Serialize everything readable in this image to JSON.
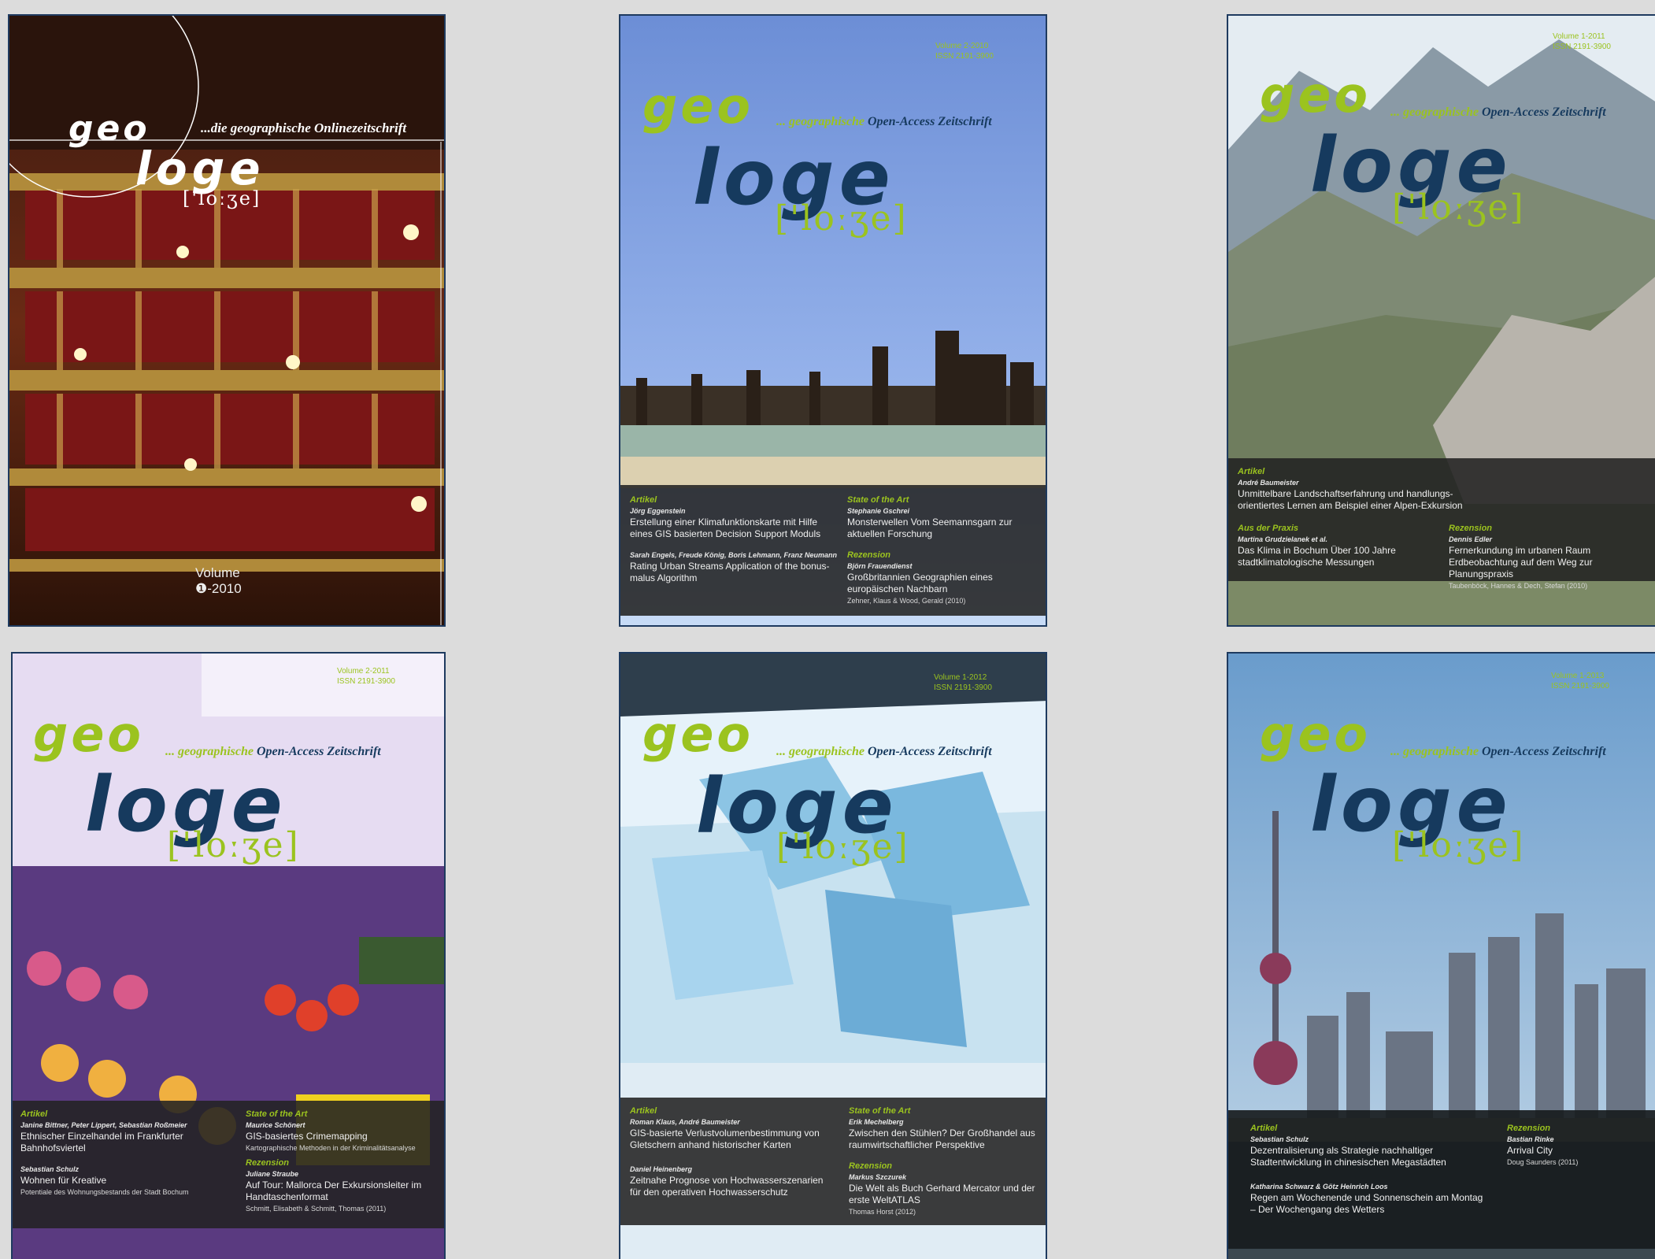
{
  "covers": [
    {
      "geo": "geo",
      "loge": "loge",
      "phonetic": "['loːʒe]",
      "tagline": "...die geographische Onlinezeitschrift",
      "volume_label": "Volume",
      "volume_number": "❶-2010"
    },
    {
      "geo": "geo",
      "loge": "loge",
      "phonetic": "['loːʒe]",
      "tagline_a": "... geographische",
      "tagline_b": "Open-Access Zeitschrift",
      "volume": "Volume 2-2010",
      "issn": "ISSN 2191-3900",
      "sections": [
        {
          "heading": "Artikel",
          "author": "Jörg Eggenstein",
          "title": "Erstellung einer Klimafunktionskarte mit Hilfe eines GIS basierten Decision Support Moduls"
        },
        {
          "heading": "",
          "author": "Sarah Engels, Freude König, Boris Lehmann, Franz Neumann",
          "title": "Rating Urban Streams Application of the bonus-malus Algorithm"
        },
        {
          "heading": "State of the Art",
          "author": "Stephanie Gschrei",
          "title": "Monsterwellen Vom Seemannsgarn zur aktuellen Forschung"
        },
        {
          "heading": "Rezension",
          "author": "Björn Frauendienst",
          "title": "Großbritannien Geographien eines europäischen Nachbarn",
          "citation": "Zehner, Klaus & Wood, Gerald (2010)"
        }
      ]
    },
    {
      "geo": "geo",
      "loge": "loge",
      "phonetic": "['loːʒe]",
      "tagline_a": "... geographische",
      "tagline_b": "Open-Access Zeitschrift",
      "volume": "Volume 1-2011",
      "issn": "ISSN 2191-3900",
      "sections": [
        {
          "heading": "Artikel",
          "author": "André Baumeister",
          "title": "Unmittelbare Landschaftserfahrung und handlungs-orientiertes Lernen am Beispiel einer Alpen-Exkursion"
        },
        {
          "heading": "Aus der Praxis",
          "author": "Martina Grudzielanek et al.",
          "title": "Das Klima in Bochum Über 100 Jahre stadtklimatologische Messungen"
        },
        {
          "heading": "Rezension",
          "author": "Dennis Edler",
          "title": "Fernerkundung im urbanen Raum Erdbeobachtung auf dem Weg zur Planungspraxis",
          "citation": "Taubenböck, Hannes & Dech, Stefan (2010)"
        }
      ]
    },
    {
      "geo": "geo",
      "loge": "loge",
      "phonetic": "['loːʒe]",
      "tagline_a": "... geographische",
      "tagline_b": "Open-Access Zeitschrift",
      "volume": "Volume 2-2011",
      "issn": "ISSN 2191-3900",
      "sections": [
        {
          "heading": "Artikel",
          "author": "Janine Bittner, Peter Lippert, Sebastian Roßmeier",
          "title": "Ethnischer Einzelhandel im Frankfurter Bahnhofsviertel"
        },
        {
          "heading": "",
          "author": "Sebastian Schulz",
          "title": "Wohnen für Kreative",
          "citation": "Potentiale des Wohnungsbestands der Stadt Bochum"
        },
        {
          "heading": "State of the Art",
          "author": "Maurice Schönert",
          "title": "GIS-basiertes Crimemapping",
          "citation": "Kartographische Methoden in der Kriminalitätsanalyse"
        },
        {
          "heading": "Rezension",
          "author": "Juliane Straube",
          "title": "Auf Tour: Mallorca Der Exkursionsleiter im Handtaschenformat",
          "citation": "Schmitt, Elisabeth & Schmitt, Thomas (2011)"
        }
      ]
    },
    {
      "geo": "geo",
      "loge": "loge",
      "phonetic": "['loːʒe]",
      "tagline_a": "... geographische",
      "tagline_b": "Open-Access Zeitschrift",
      "volume": "Volume 1-2012",
      "issn": "ISSN 2191-3900",
      "sections": [
        {
          "heading": "Artikel",
          "author": "Roman Klaus, André Baumeister",
          "title": "GIS-basierte Verlustvolumenbestimmung von Gletschern anhand historischer Karten"
        },
        {
          "heading": "",
          "author": "Daniel Heinenberg",
          "title": "Zeitnahe Prognose von Hochwasserszenarien für den operativen Hochwasserschutz"
        },
        {
          "heading": "State of the Art",
          "author": "Erik Mechelberg",
          "title": "Zwischen den Stühlen? Der Großhandel aus raumwirtschaftlicher Perspektive"
        },
        {
          "heading": "Rezension",
          "author": "Markus Szczurek",
          "title": "Die Welt als Buch Gerhard Mercator und der erste WeltATLAS",
          "citation": "Thomas Horst (2012)"
        }
      ]
    },
    {
      "geo": "geo",
      "loge": "loge",
      "phonetic": "['loːʒe]",
      "tagline_a": "... geographische",
      "tagline_b": "Open-Access Zeitschrift",
      "volume": "Volume 1-2013",
      "issn": "ISSN 2191-3900",
      "sections": [
        {
          "heading": "Artikel",
          "author": "Sebastian Schulz",
          "title": "Dezentralisierung als Strategie nachhaltiger Stadtentwicklung in chinesischen Megastädten"
        },
        {
          "heading": "",
          "author": "Katharina Schwarz & Götz Heinrich Loos",
          "title": "Regen am Wochenende und Sonnenschein am Montag – Der Wochengang des Wetters"
        },
        {
          "heading": "Rezension",
          "author": "Bastian Rinke",
          "title": "Arrival City",
          "citation": "Doug Saunders (2011)"
        }
      ]
    }
  ]
}
